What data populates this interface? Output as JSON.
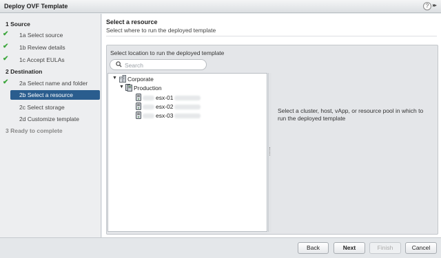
{
  "window": {
    "title": "Deploy OVF Template",
    "help_icon": "?",
    "expand_icon": "▸▸"
  },
  "steps": [
    {
      "label": "1  Source",
      "level": "head",
      "state": "done-head"
    },
    {
      "label": "1a Select source",
      "level": "sub",
      "state": "complete"
    },
    {
      "label": "1b Review details",
      "level": "sub",
      "state": "complete"
    },
    {
      "label": "1c Accept EULAs",
      "level": "sub",
      "state": "complete"
    },
    {
      "label": "2  Destination",
      "level": "head",
      "state": "current-head"
    },
    {
      "label": "2a Select name and folder",
      "level": "sub",
      "state": "complete"
    },
    {
      "label": "2b Select a resource",
      "level": "sub",
      "state": "active"
    },
    {
      "label": "2c Select storage",
      "level": "sub",
      "state": "pending"
    },
    {
      "label": "2d Customize template",
      "level": "sub",
      "state": "pending"
    },
    {
      "label": "3  Ready to complete",
      "level": "head",
      "state": "disabled"
    }
  ],
  "content": {
    "title": "Select a resource",
    "subtitle": "Select where to run the deployed template",
    "panel_label": "Select location to run the deployed template",
    "search": {
      "placeholder": "Search",
      "value": ""
    },
    "tree": {
      "datacenter": {
        "label": "Corporate",
        "icon": "datacenter-icon",
        "expanded": true
      },
      "cluster": {
        "label": "Production",
        "icon": "cluster-icon",
        "expanded": true
      },
      "hosts": [
        {
          "label": "esx-01",
          "icon": "host-icon"
        },
        {
          "label": "esx-02",
          "icon": "host-icon"
        },
        {
          "label": "esx-03",
          "icon": "host-icon"
        }
      ]
    },
    "info_message": "Select a cluster, host, vApp, or resource pool in which to run the deployed template"
  },
  "footer": {
    "back": "Back",
    "next": "Next",
    "finish": "Finish",
    "cancel": "Cancel"
  },
  "colors": {
    "accent": "#2a5d8e",
    "check": "#3ca63c"
  }
}
